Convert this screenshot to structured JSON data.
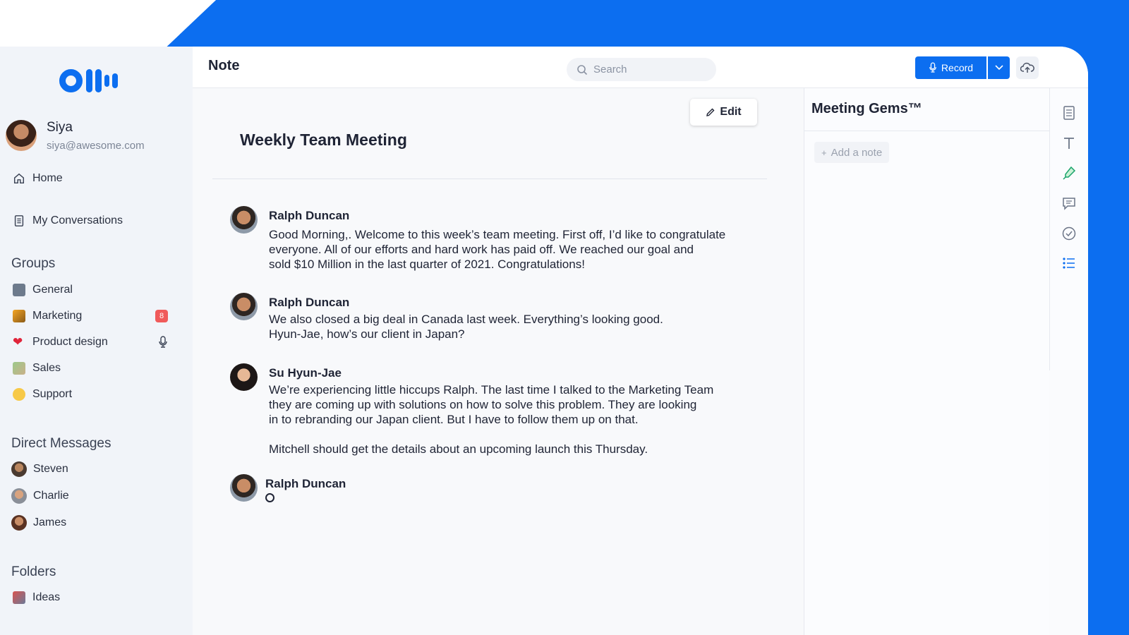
{
  "brand": {
    "logo_text": "Otter",
    "accent": "#0c6ef0"
  },
  "user": {
    "name": "Siya",
    "email": "siya@awesome.com"
  },
  "nav": {
    "home": "Home",
    "conversations": "My Conversations"
  },
  "groups": {
    "heading": "Groups",
    "items": [
      {
        "label": "General",
        "icon": "building-emoji"
      },
      {
        "label": "Marketing",
        "icon": "megaphone-emoji",
        "badge": "8"
      },
      {
        "label": "Product design",
        "icon": "heart-emoji",
        "status_icon": "mic-icon"
      },
      {
        "label": "Sales",
        "icon": "money-emoji"
      },
      {
        "label": "Support",
        "icon": "smile-emoji"
      }
    ]
  },
  "direct_messages": {
    "heading": "Direct Messages",
    "items": [
      {
        "label": "Steven"
      },
      {
        "label": "Charlie"
      },
      {
        "label": "James"
      }
    ]
  },
  "folders": {
    "heading": "Folders",
    "items": [
      {
        "label": "Ideas",
        "icon": "rocket-emoji"
      }
    ]
  },
  "header": {
    "title": "Note",
    "search_placeholder": "Search",
    "record_label": "Record"
  },
  "note": {
    "edit_label": "Edit",
    "title": "Weekly Team Meeting",
    "messages": [
      {
        "speaker": "Ralph Duncan",
        "text": "Good Morning,. Welcome to this week’s team meeting. First off, I’d like to congratulate\neveryone. All of our efforts and hard work has paid off. We reached our goal and\nsold $10 Million in the last quarter of 2021. Congratulations!"
      },
      {
        "speaker": "Ralph Duncan",
        "text": "We also closed a big deal in Canada last week. Everything’s looking good.\nHyun-Jae, how’s our client in Japan?"
      },
      {
        "speaker": "Su Hyun-Jae",
        "text": "We’re experiencing little hiccups Ralph. The last time I talked to the Marketing Team\nthey are coming up with solutions on how to solve this problem. They are looking\nin to rebranding our Japan client. But I have to follow them up on that.\n\nMitchell should get the details about an upcoming launch this Thursday."
      },
      {
        "speaker": "Ralph Duncan",
        "text": ""
      }
    ]
  },
  "gems": {
    "title": "Meeting Gems™",
    "add_note": "Add a note"
  },
  "rail_icons": [
    "document-icon",
    "text-icon",
    "highlight-icon",
    "comment-icon",
    "check-circle-icon",
    "list-icon"
  ]
}
